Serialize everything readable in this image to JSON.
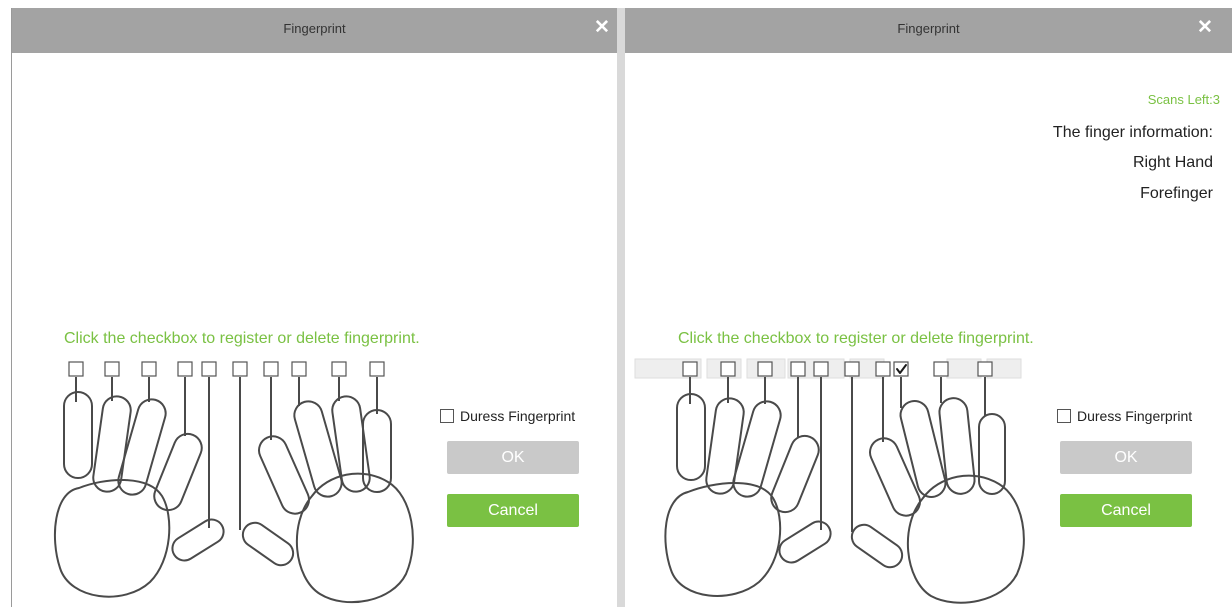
{
  "left_dialog": {
    "title": "Fingerprint",
    "close_icon": "close-icon",
    "instruction": "Click the checkbox to register or delete fingerprint.",
    "finger_checkboxes": [
      false,
      false,
      false,
      false,
      false,
      false,
      false,
      false,
      false,
      false
    ],
    "duress_label": "Duress Fingerprint",
    "duress_checked": false,
    "ok_label": "OK",
    "cancel_label": "Cancel"
  },
  "right_dialog": {
    "title": "Fingerprint",
    "close_icon": "close-icon",
    "scans_left": "Scans Left:3",
    "finger_info_title": "The finger information:",
    "finger_info_hand": "Right Hand",
    "finger_info_finger": "Forefinger",
    "instruction": "Click the checkbox to register or delete fingerprint.",
    "finger_checkboxes": [
      false,
      false,
      false,
      false,
      false,
      false,
      true,
      false,
      false,
      false
    ],
    "duress_label": "Duress Fingerprint",
    "duress_checked": false,
    "ok_label": "OK",
    "cancel_label": "Cancel"
  },
  "colors": {
    "accent_green": "#7ac143",
    "title_bar": "#a3a3a3",
    "disabled_button": "#c9c9c9"
  }
}
